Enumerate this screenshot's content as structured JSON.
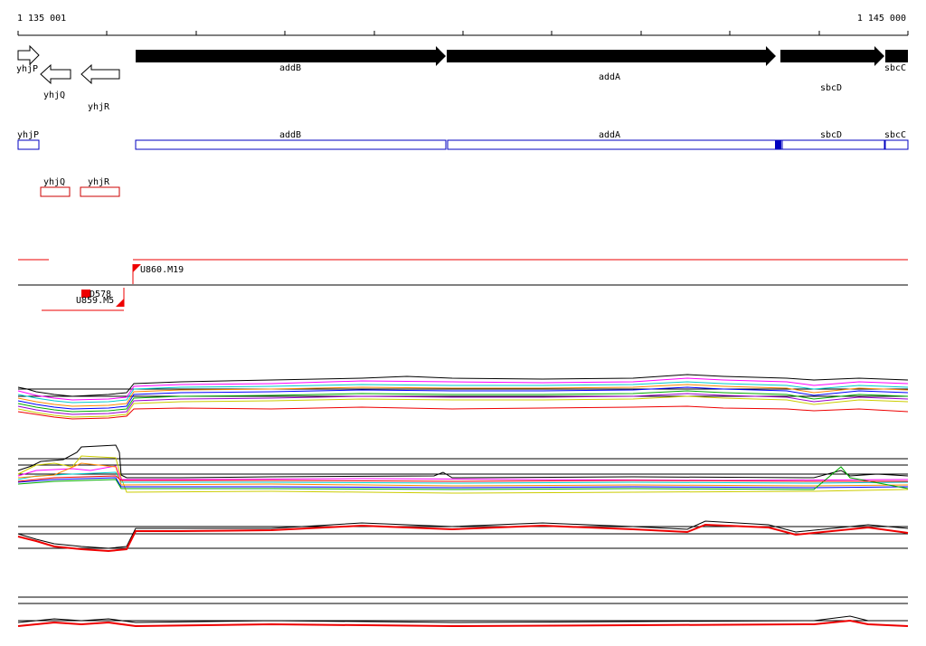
{
  "ruler": {
    "start": "1 135 001",
    "end": "1 145 000"
  },
  "gene_arrows": {
    "forward": [
      "yhjP",
      "addB",
      "addA",
      "sbcD",
      "sbcC"
    ],
    "reverse": [
      "yhjQ",
      "yhjR"
    ]
  },
  "annotation_boxes": {
    "blue": [
      "yhjP",
      "addB",
      "addA",
      "sbcD",
      "sbcC"
    ],
    "red": [
      "yhjQ",
      "yhjR"
    ]
  },
  "features": {
    "forward_label": "U860.M19",
    "reverse_labels": [
      "D578",
      "U859.M5"
    ]
  },
  "colors": {
    "forward_box": "#0000c0",
    "reverse_box": "#cc0000",
    "arrow_fill": "#000000",
    "feature": "#ee0000"
  }
}
